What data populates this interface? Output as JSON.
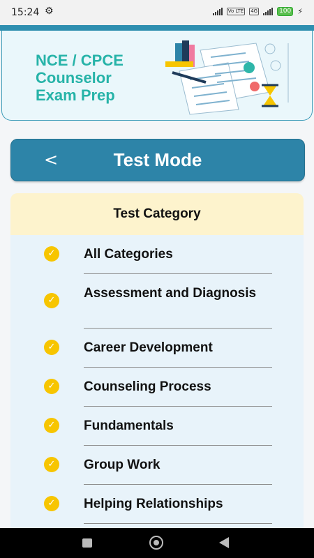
{
  "status": {
    "time": "15:24",
    "lte_tag": "Vo LTE",
    "net_tag": "4G",
    "battery": "100"
  },
  "banner": {
    "line1": "NCE / CPCE",
    "line2": "Counselor",
    "line3": "Exam Prep"
  },
  "header": {
    "back_symbol": "<",
    "title": "Test Mode"
  },
  "category": {
    "heading": "Test Category",
    "items": [
      {
        "label": "All Categories"
      },
      {
        "label": "Assessment and Diagnosis"
      },
      {
        "label": "Career Development"
      },
      {
        "label": "Counseling Process"
      },
      {
        "label": "Fundamentals"
      },
      {
        "label": "Group Work"
      },
      {
        "label": "Helping Relationships"
      }
    ]
  },
  "colors": {
    "accent": "#2d84a8",
    "banner_text": "#26b3a8",
    "check": "#f7c500",
    "panel_bg": "#e8f3fa",
    "heading_bg": "#fdf3cd"
  },
  "icons": {
    "back": "chevron-left-icon",
    "check": "checkmark-circle-icon",
    "nav_recent": "square-icon",
    "nav_home": "circle-icon",
    "nav_back": "triangle-back-icon"
  }
}
